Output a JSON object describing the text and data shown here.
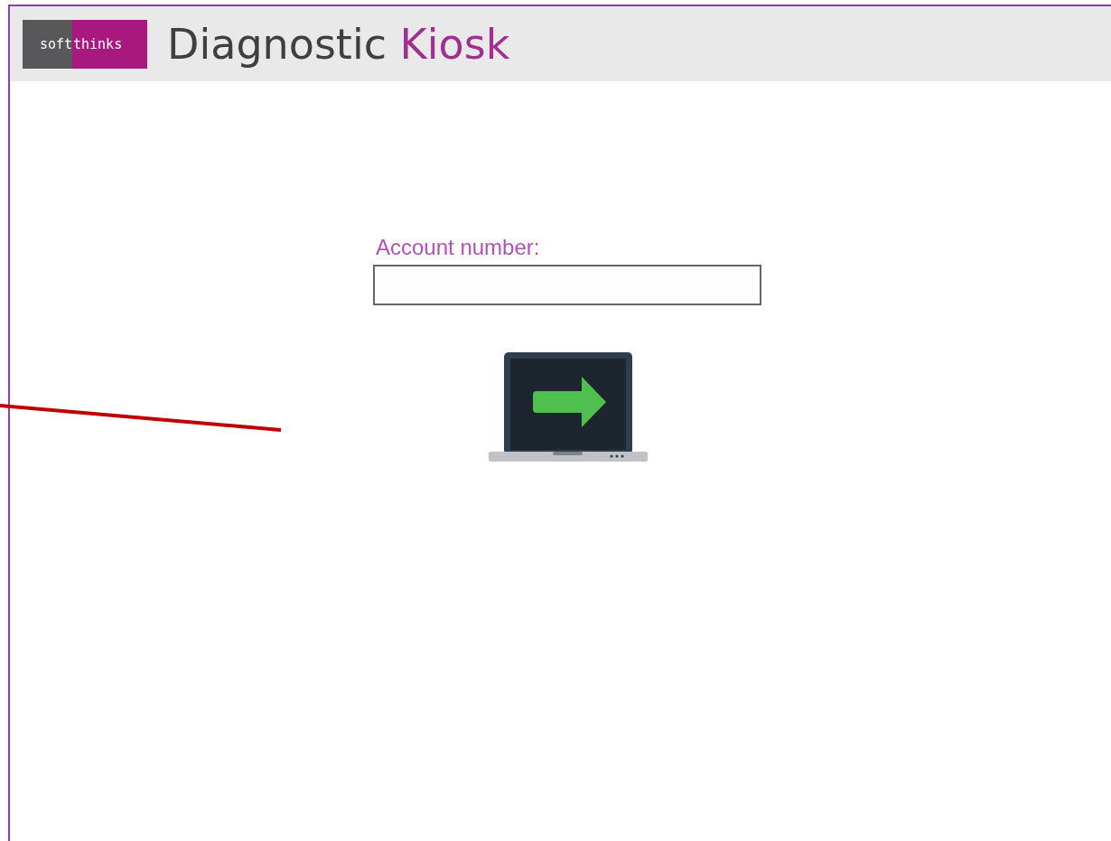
{
  "logo": {
    "left": "soft",
    "right": "thinks"
  },
  "title": [
    {
      "text": "Diagnostic",
      "accent": false
    },
    {
      "text": "Kiosk",
      "accent": true
    }
  ],
  "form": {
    "label": "Account number:"
  }
}
